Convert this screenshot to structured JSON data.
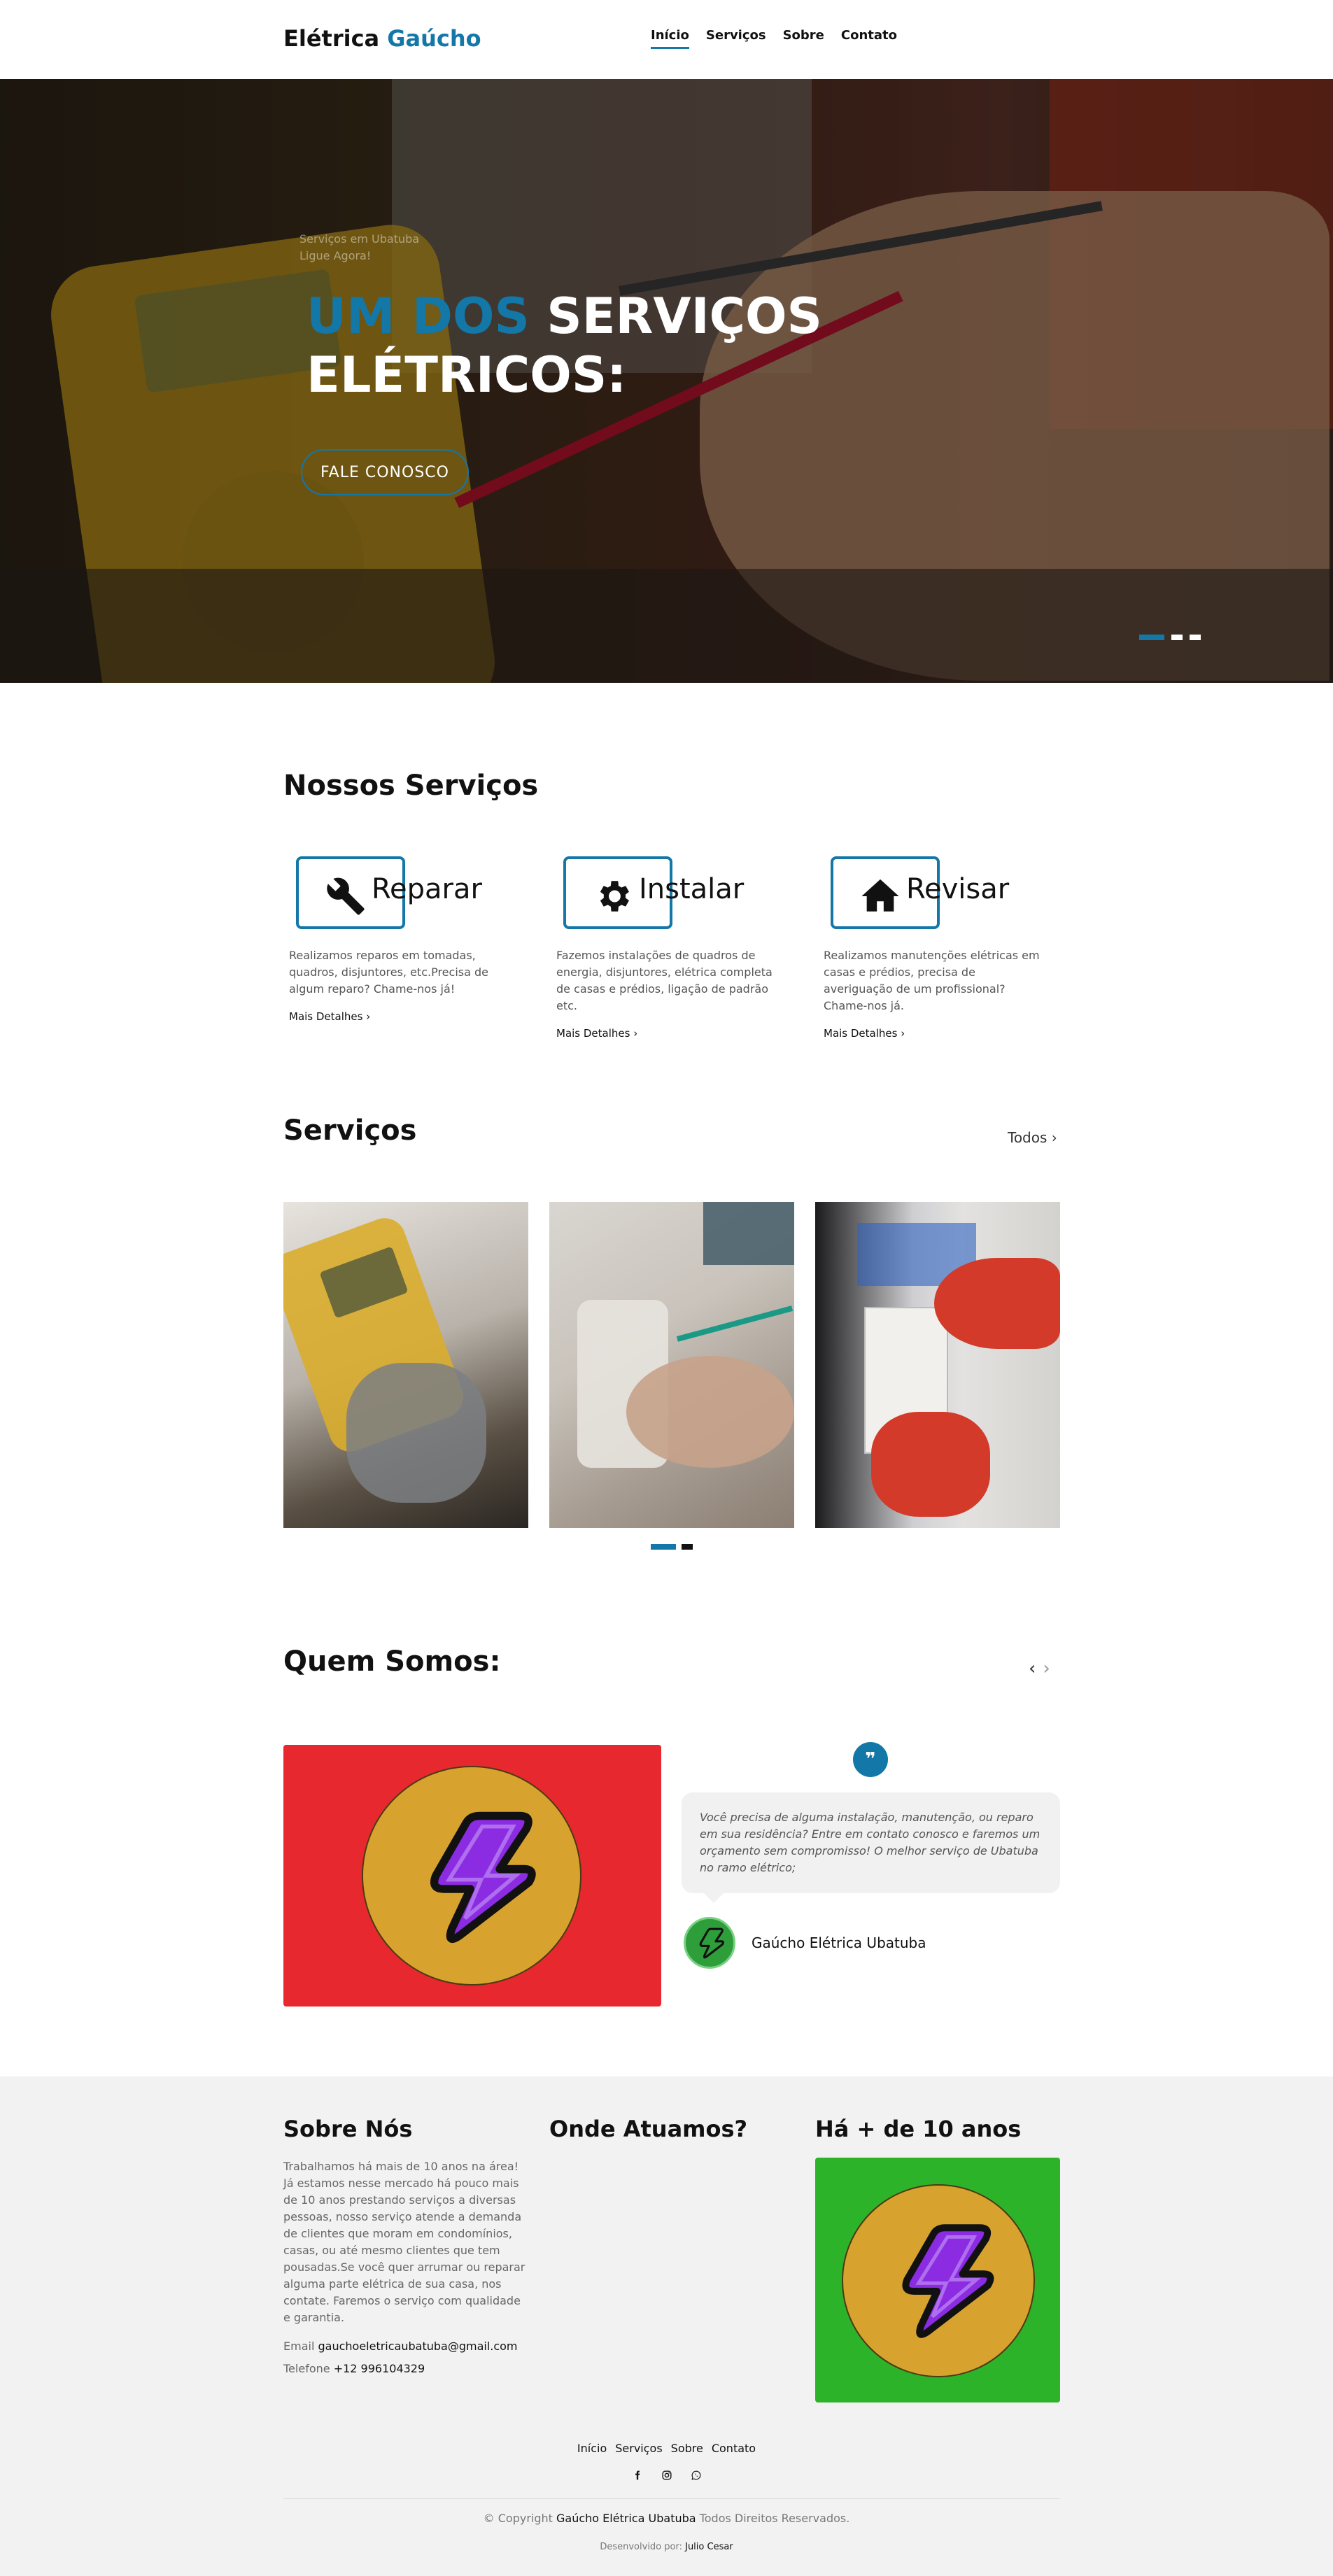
{
  "header": {
    "logo_main": "Elétrica",
    "logo_accent": "Gaúcho",
    "nav": [
      "Início",
      "Serviços",
      "Sobre",
      "Contato"
    ]
  },
  "hero": {
    "subtitle_line1": "Serviços em Ubatuba",
    "subtitle_line2": "Ligue Agora!",
    "title_accent": "UM DOS",
    "title_rest_line1": "SERVIÇOS",
    "title_line2": "ELÉTRICOS:",
    "button": "FALE CONOSCO"
  },
  "services": {
    "title": "Nossos Serviços",
    "cards": [
      {
        "name": "Reparar",
        "icon": "wrench-icon",
        "desc": "Realizamos reparos em tomadas, quadros, disjuntores, etc.Precisa de algum reparo? Chame-nos já!",
        "more": "Mais Detalhes"
      },
      {
        "name": "Instalar",
        "icon": "gear-icon",
        "desc": "Fazemos instalações de quadros de energia, disjuntores, elétrica completa de casas e prédios, ligação de padrão etc.",
        "more": "Mais Detalhes"
      },
      {
        "name": "Revisar",
        "icon": "home-icon",
        "desc": "Realizamos manutenções elétricas em casas e prédios, precisa de averiguação de um profissional? Chame-nos já.",
        "more": "Mais Detalhes"
      }
    ]
  },
  "gallery": {
    "title": "Serviços",
    "all_label": "Todos"
  },
  "about": {
    "title": "Quem Somos:",
    "quote": "Você precisa de alguma instalação, manutenção, ou reparo em sua residência? Entre em contato conosco e faremos um orçamento sem compromisso! O melhor serviço de Ubatuba no ramo elétrico;",
    "author": "Gaúcho Elétrica Ubatuba"
  },
  "footer": {
    "col1_title": "Sobre Nós",
    "col1_text": "Trabalhamos há mais de 10 anos na área! Já estamos nesse mercado há pouco mais de 10 anos prestando serviços a diversas pessoas, nosso serviço atende a demanda de clientes que moram em condomínios, casas, ou até mesmo clientes que tem pousadas.Se você quer arrumar ou reparar alguma parte elétrica de sua casa, nos contate. Faremos o serviço com qualidade e garantia.",
    "email_label": "Email",
    "email": "gauchoeletricaubatuba@gmail.com",
    "phone_label": "Telefone",
    "phone": "+12 996104329",
    "col2_title": "Onde Atuamos?",
    "col3_title": "Há + de 10 anos",
    "links": [
      "Início",
      "Serviços",
      "Sobre",
      "Contato"
    ],
    "copy_prefix": "© Copyright",
    "copy_brand": "Gaúcho Elétrica Ubatuba",
    "copy_suffix": "Todos Direitos Reservados.",
    "dev_label": "Desenvolvido por:",
    "dev_name": "Julio Cesar"
  },
  "colors": {
    "accent": "#1377a8",
    "about_bg": "#e7282e",
    "badge_bg": "#2db329",
    "bolt": "#8b2be2"
  }
}
